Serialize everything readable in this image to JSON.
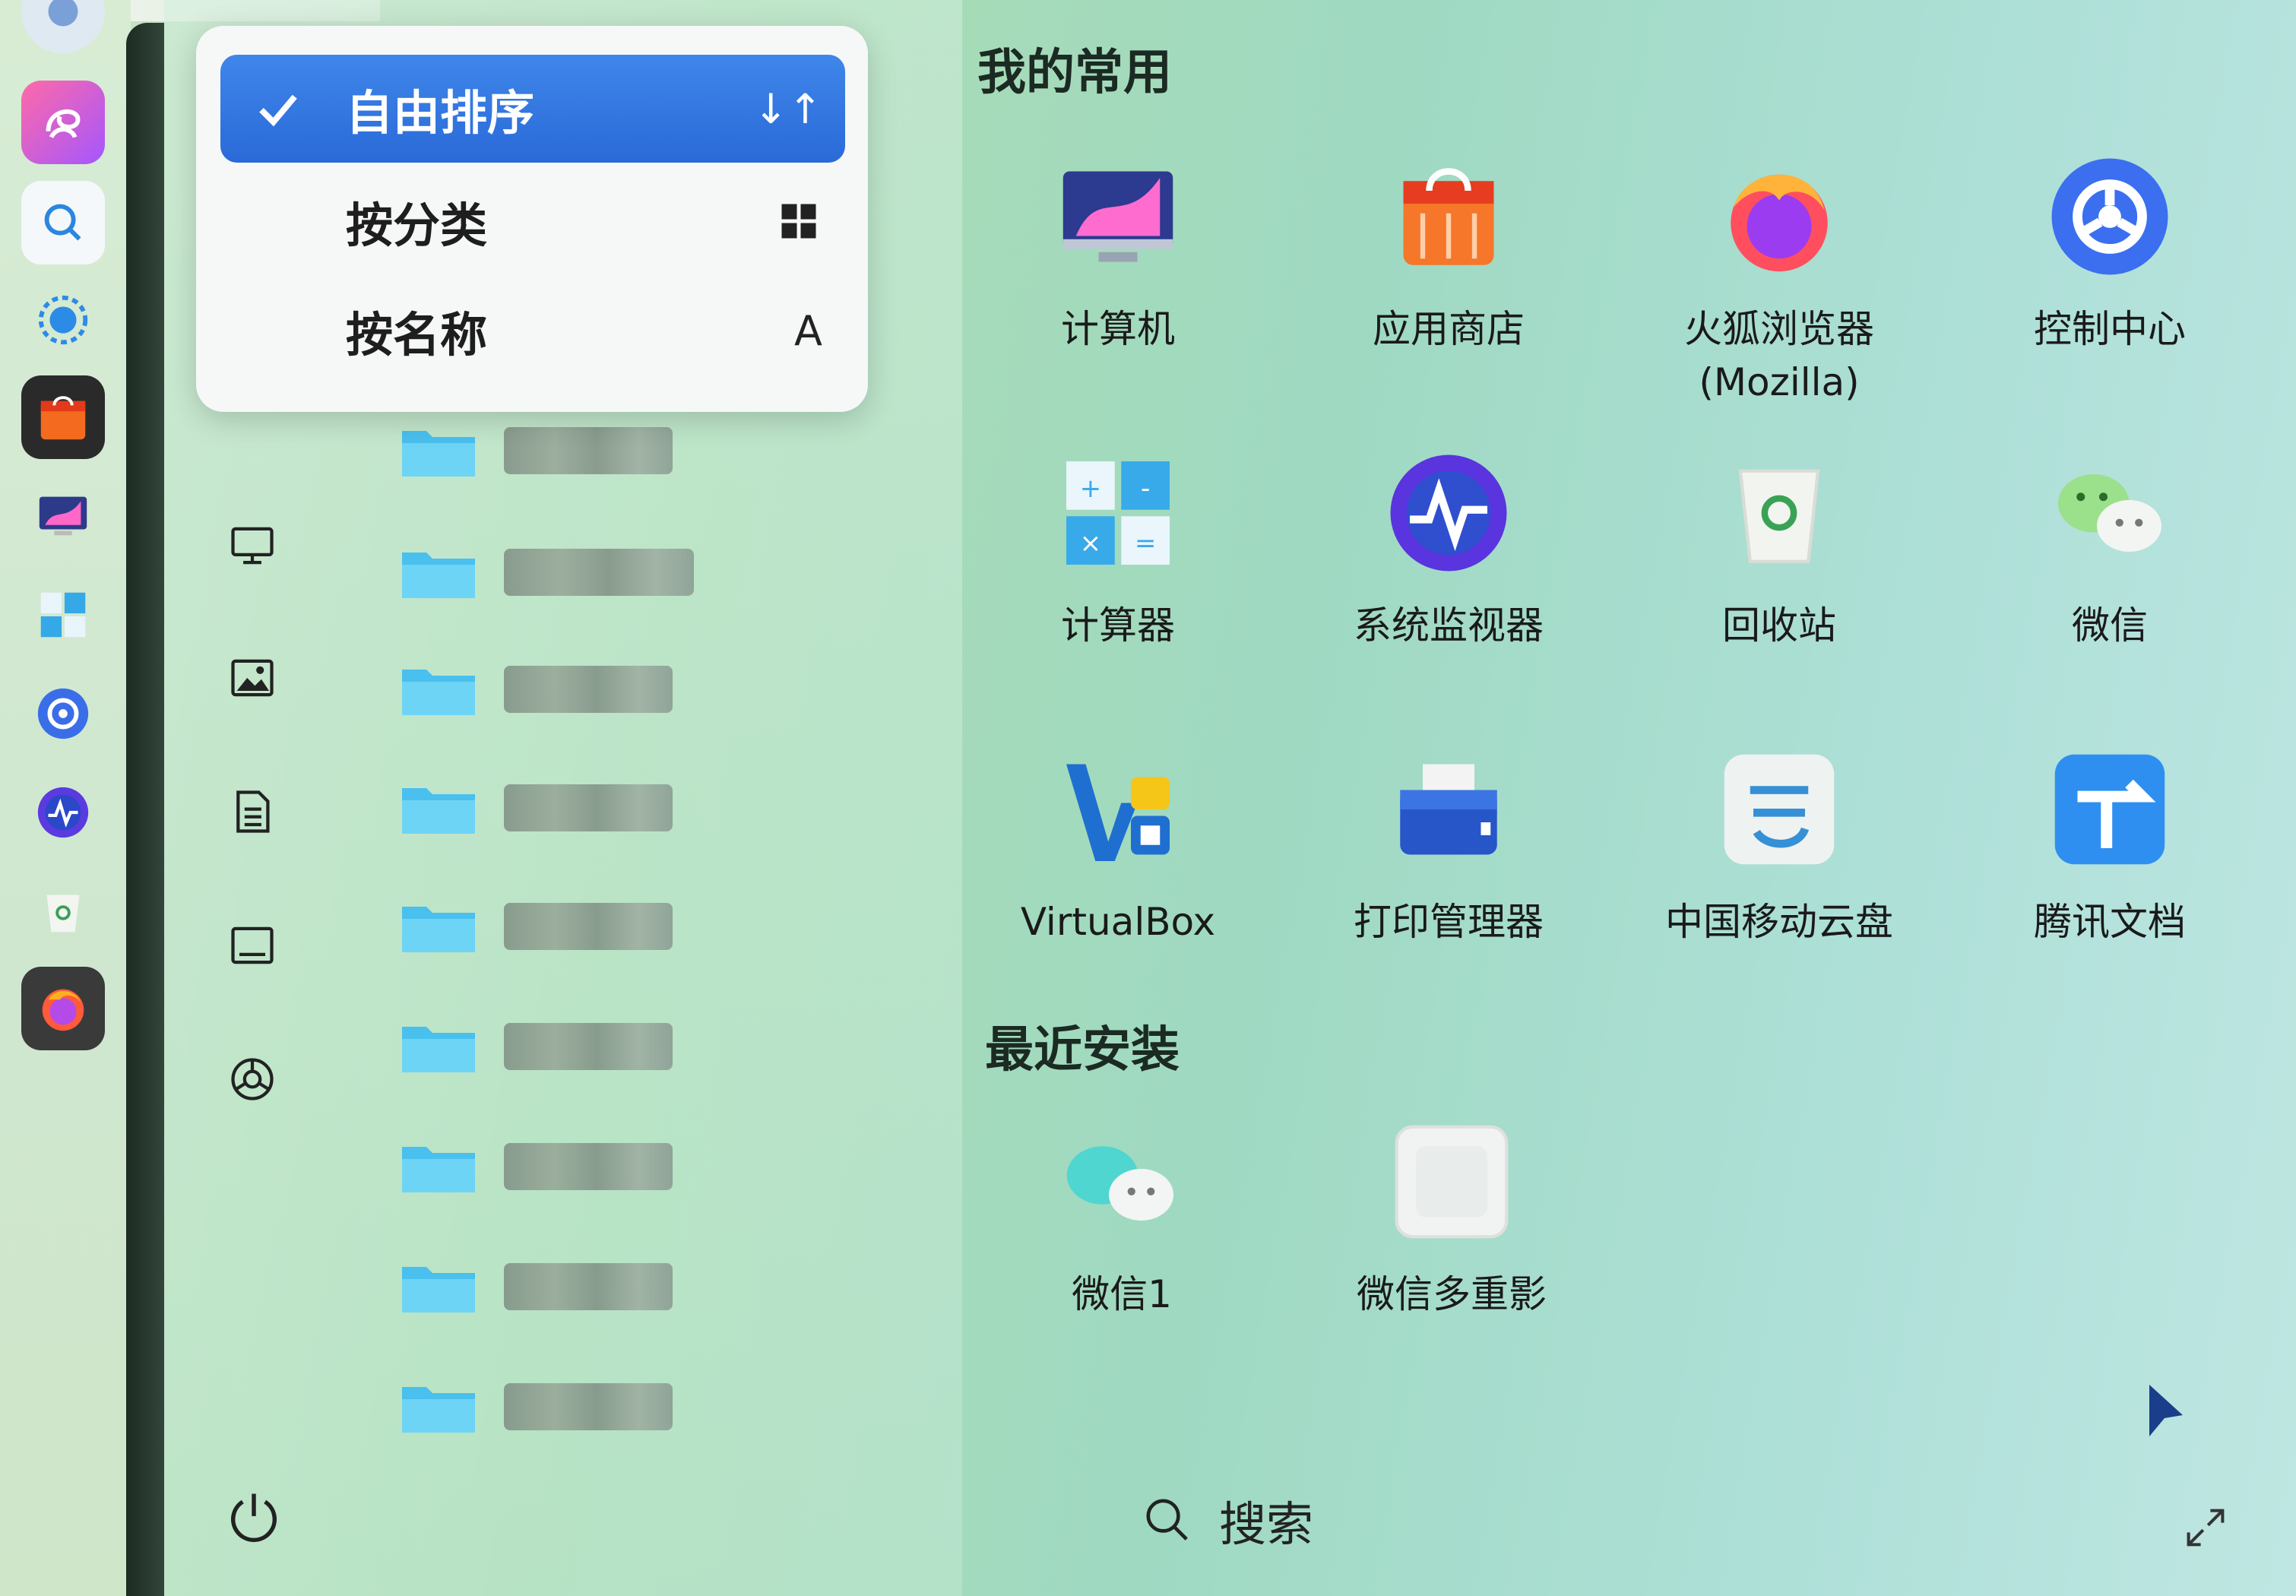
{
  "sort_menu": {
    "items": [
      {
        "label": "自由排序",
        "right": "↓↑",
        "selected": true
      },
      {
        "label": "按分类",
        "right": "▪▪",
        "selected": false
      },
      {
        "label": "按名称",
        "right": "A",
        "selected": false
      }
    ]
  },
  "favorites": {
    "title": "我的常用",
    "apps": [
      {
        "name": "计算机",
        "icon": "computer-icon"
      },
      {
        "name": "应用商店",
        "icon": "app-store-icon"
      },
      {
        "name": "火狐浏览器\n(Mozilla)",
        "icon": "firefox-icon"
      },
      {
        "name": "控制中心",
        "icon": "control-center-icon"
      },
      {
        "name": "计算器",
        "icon": "calculator-icon"
      },
      {
        "name": "系统监视器",
        "icon": "system-monitor-icon"
      },
      {
        "name": "回收站",
        "icon": "trash-icon"
      },
      {
        "name": "微信",
        "icon": "wechat-icon"
      },
      {
        "name": "VirtualBox",
        "icon": "virtualbox-icon"
      },
      {
        "name": "打印管理器",
        "icon": "printer-icon"
      },
      {
        "name": "中国移动云盘",
        "icon": "cloud-disk-icon"
      },
      {
        "name": "腾讯文档",
        "icon": "tencent-docs-icon"
      }
    ]
  },
  "recent": {
    "title": "最近安装",
    "apps": [
      {
        "name": "微信1",
        "icon": "wechat-icon"
      },
      {
        "name": "微信多重影",
        "icon": "generic-app-icon"
      }
    ]
  },
  "search": {
    "label": "搜索"
  },
  "colors": {
    "accent": "#2f74e0",
    "text": "#1a1a1a"
  }
}
